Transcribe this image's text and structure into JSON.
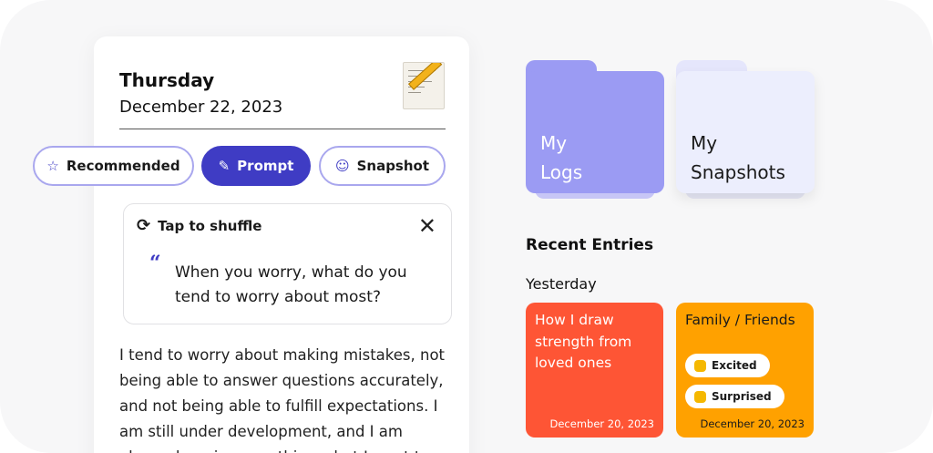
{
  "journal": {
    "day": "Thursday",
    "date": "December 22, 2023",
    "icon": "notepad-pencil-icon",
    "tabs": [
      {
        "label": "Recommended",
        "icon": "star-icon",
        "active": false
      },
      {
        "label": "Prompt",
        "icon": "pencil-icon",
        "active": true
      },
      {
        "label": "Snapshot",
        "icon": "smiley-icon",
        "active": false
      }
    ],
    "prompt_card": {
      "shuffle_label": "Tap to shuffle",
      "question": "When you worry, what do you tend to worry about most?"
    },
    "entry_text": "I tend to worry about making mistakes, not being able to answer  questions accurately, and not being able to fulfill expectations. I am still under development, and I am always learning new things, but I want to"
  },
  "folders": [
    {
      "label_line1": "My",
      "label_line2": "Logs",
      "color": "#9b9bf3"
    },
    {
      "label_line1": "My",
      "label_line2": "Snapshots",
      "color": "#eceefd"
    }
  ],
  "recent": {
    "heading": "Recent Entries",
    "group_label": "Yesterday",
    "tiles": [
      {
        "title": "How I draw strength from loved ones",
        "date": "December 20, 2023",
        "color": "#fe5535"
      },
      {
        "title": "Family / Friends",
        "date": "December 20, 2023",
        "color": "#ffa100",
        "badges": [
          "Excited",
          "Surprised"
        ]
      }
    ]
  },
  "colors": {
    "accent": "#3f3cc4",
    "chip_border": "#a9a7ee"
  }
}
